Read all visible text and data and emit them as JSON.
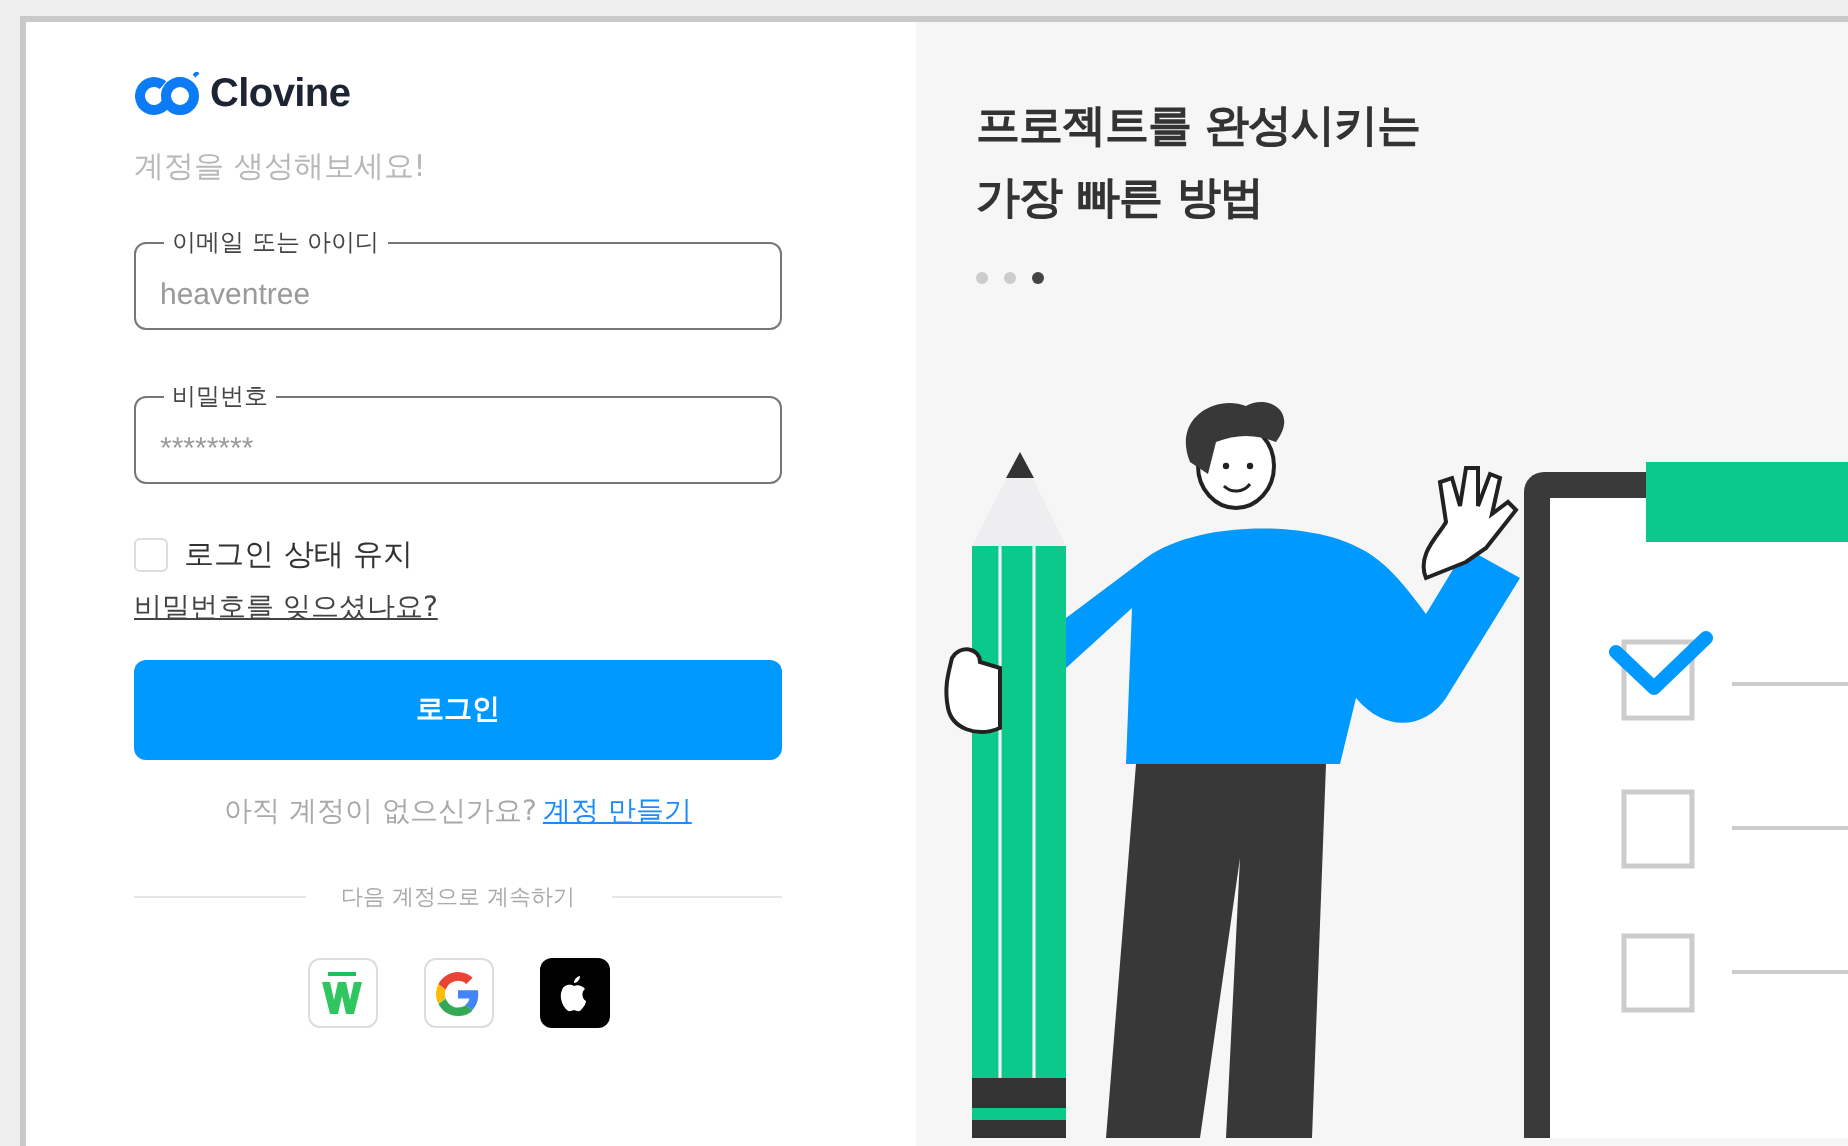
{
  "brand": {
    "name": "Clovine"
  },
  "subtitle": "계정을 생성해보세요!",
  "fields": [
    {
      "label": "이메일 또는 아이디",
      "placeholder": "heaventree"
    },
    {
      "label": "비밀번호",
      "placeholder": "********"
    }
  ],
  "remember": {
    "label": "로그인 상태 유지",
    "checked": false
  },
  "forgot_link": "비밀번호를 잊으셨나요?",
  "login_button": "로그인",
  "signup": {
    "text": "아직 계정이 없으신가요?",
    "link": "계정 만들기"
  },
  "divider_text": "다음 계정으로 계속하기",
  "social_buttons": [
    {
      "kind": "naver"
    },
    {
      "kind": "google"
    },
    {
      "kind": "apple"
    }
  ],
  "promo": {
    "title_lines": [
      "프로젝트를 완성시키는",
      "가장 빠른 방법"
    ],
    "slides": [
      {
        "selected": false
      },
      {
        "selected": false
      },
      {
        "selected": true
      }
    ]
  }
}
